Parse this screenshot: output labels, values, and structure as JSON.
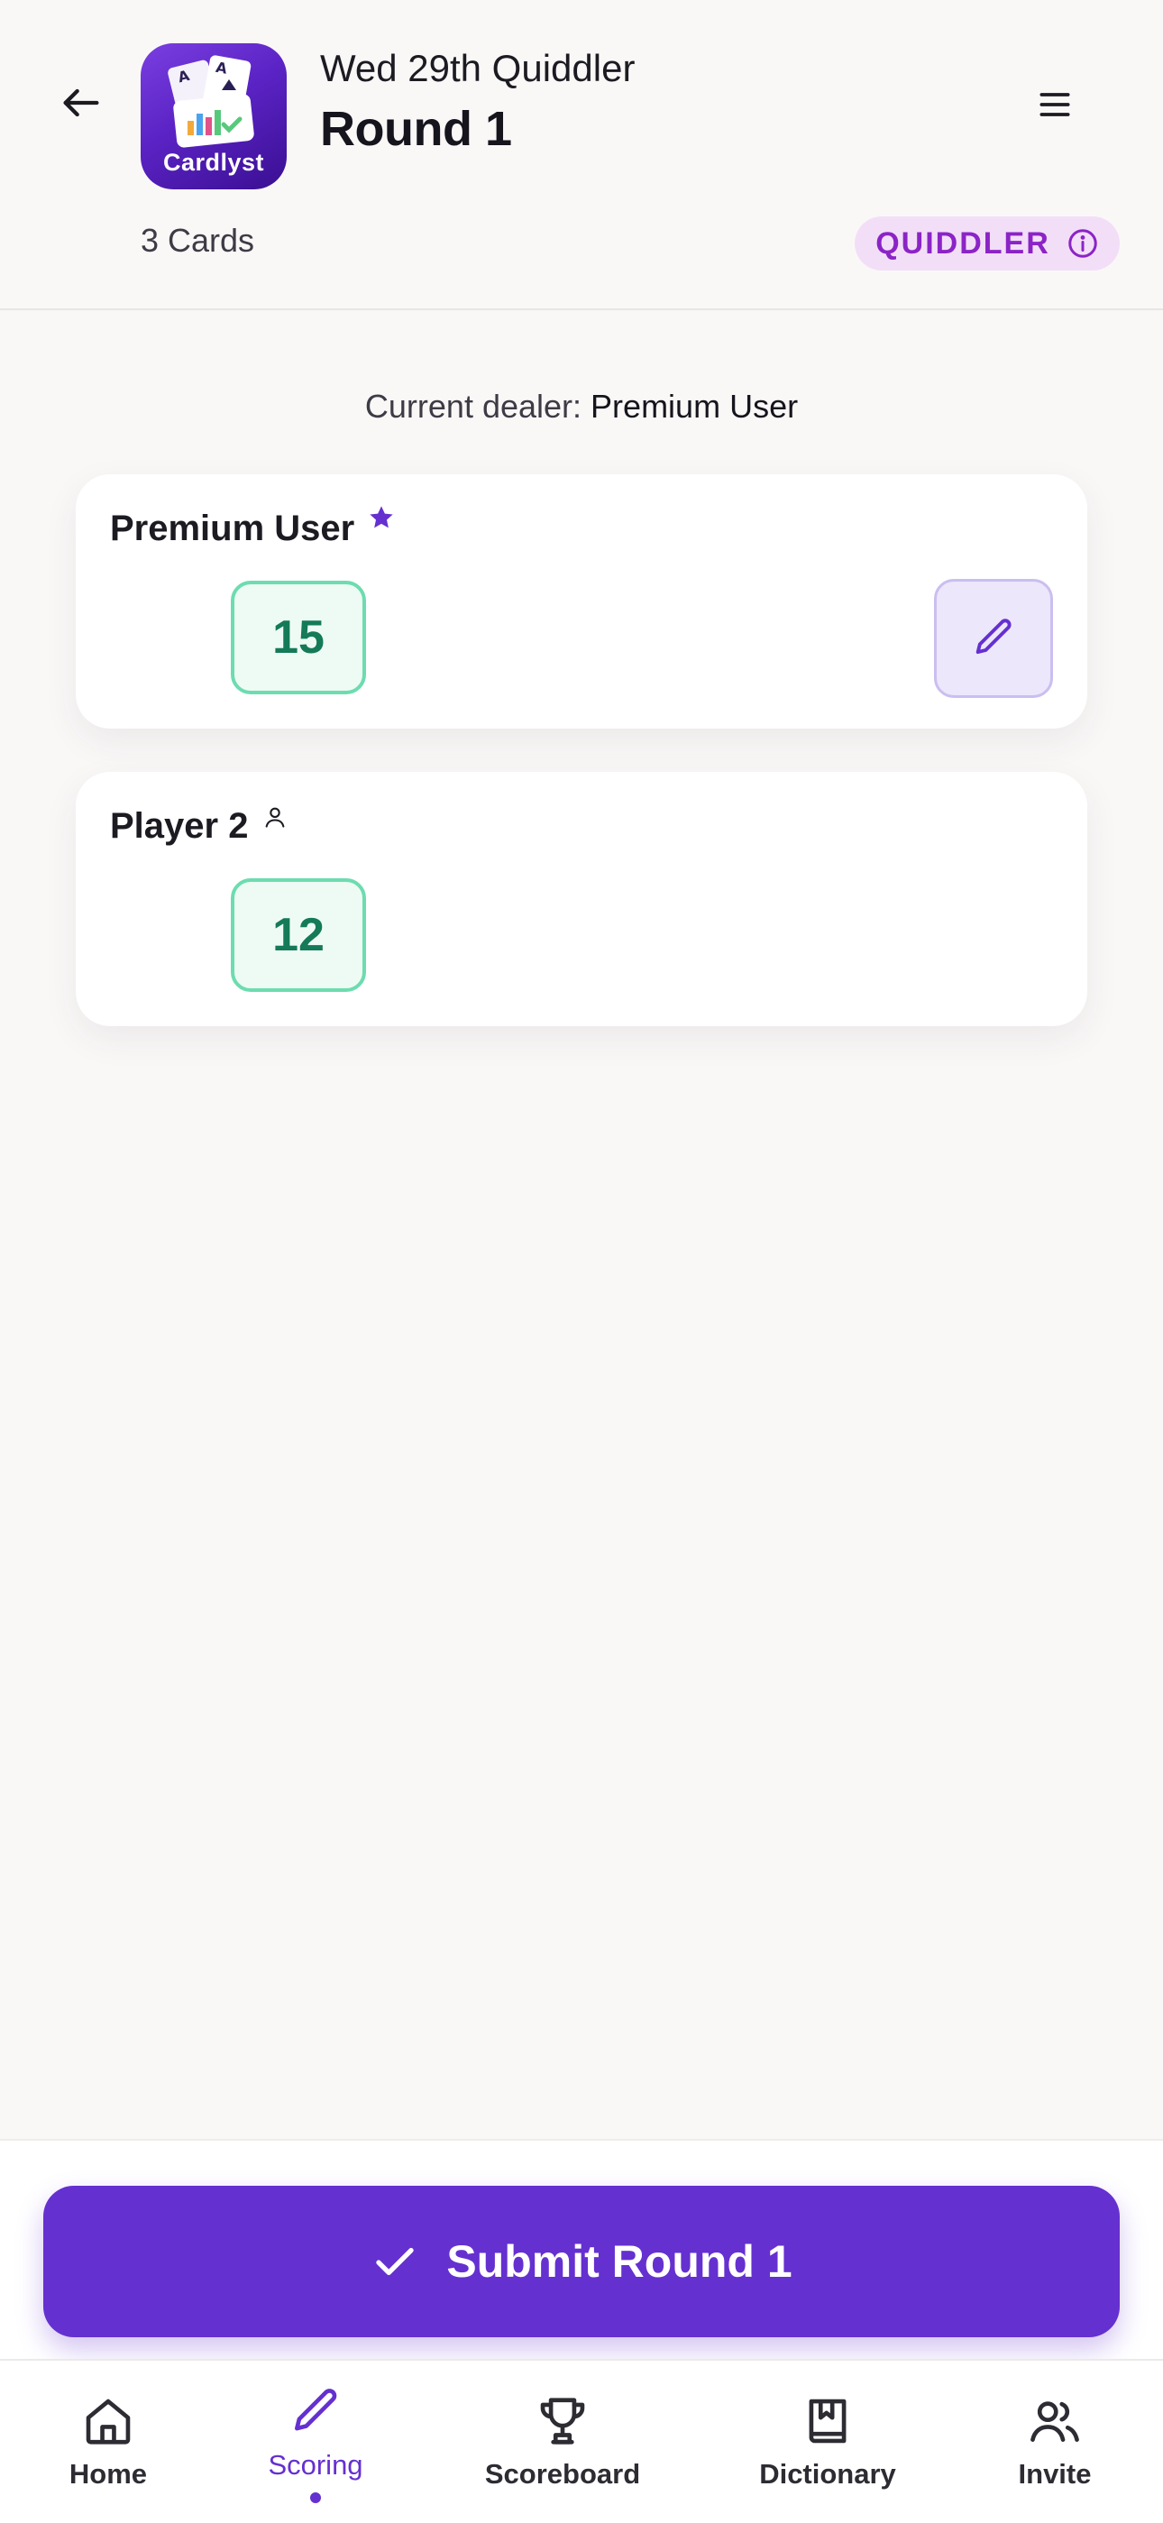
{
  "header": {
    "title": "Wed 29th Quiddler",
    "subtitle": "Round 1",
    "app_name": "Cardlyst",
    "cards_count": "3 Cards",
    "game_badge": "QUIDDLER"
  },
  "dealer": {
    "label": "Current dealer:",
    "name": "Premium User"
  },
  "players": [
    {
      "name": "Premium User",
      "score": "15",
      "icon": "star-icon"
    },
    {
      "name": "Player 2",
      "score": "12",
      "icon": "person-icon"
    }
  ],
  "submit": {
    "label": "Submit Round 1"
  },
  "nav": {
    "items": [
      {
        "label": "Home",
        "icon": "home-icon"
      },
      {
        "label": "Scoring",
        "icon": "pencil-icon",
        "active": true
      },
      {
        "label": "Scoreboard",
        "icon": "trophy-icon"
      },
      {
        "label": "Dictionary",
        "icon": "book-icon"
      },
      {
        "label": "Invite",
        "icon": "users-icon"
      }
    ]
  },
  "colors": {
    "accent": "#6530d0",
    "score_border": "#6ddcb0",
    "score_text": "#147a58",
    "badge_bg": "#f3def8",
    "badge_text": "#8b24c6"
  }
}
